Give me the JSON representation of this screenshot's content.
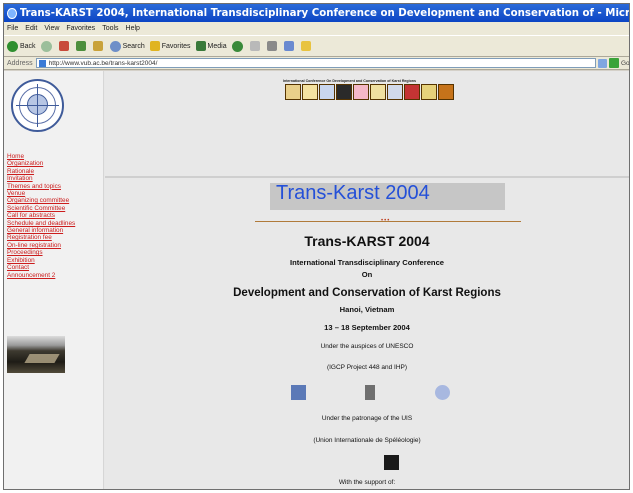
{
  "window": {
    "title": "Trans-KARST 2004, International Transdisciplinary Conference on Development and Conservation of - Microsoft Internet E..."
  },
  "menu": [
    "File",
    "Edit",
    "View",
    "Favorites",
    "Tools",
    "Help"
  ],
  "toolbar": {
    "back": "Back",
    "search": "Search",
    "favorites": "Favorites",
    "media": "Media"
  },
  "address": {
    "label": "Address",
    "url": "http://www.vub.ac.be/trans-karst2004/",
    "go": "Go"
  },
  "sidebar": {
    "links": [
      "Home",
      "Organization",
      "Rationale",
      "Invitation",
      "Themes and topics",
      "Venue",
      "Organizing committee",
      "Scientific Committee",
      "Call for abstracts",
      "Schedule and deadlines",
      "General information",
      "Registration fee",
      "On-line registration",
      "Proceedings",
      "Exhibition",
      "Contact",
      "Announcement 2"
    ]
  },
  "content": {
    "banner_caption": "International Conference On Development and Conservation of Karst Regions",
    "banner_title": "Trans-Karst 2004",
    "divider_dots": "•••",
    "heading": "Trans-KARST 2004",
    "subheading": "International Transdisciplinary Conference",
    "on": "On",
    "theme": "Development and Conservation of Karst Regions",
    "location": "Hanoi, Vietnam",
    "dates": "13 – 18 September 2004",
    "auspices": "Under the auspices of UNESCO",
    "projects": "(IGCP Project 448 and IHP)",
    "patronage": "Under the patronage of the UIS",
    "uis_full": "(Union Internationale de Spéléologie)",
    "support": "With the support of:"
  },
  "colors": {
    "link": "#cc1c1c",
    "banner_title": "#2450d8",
    "titlebar": "#0c45c4"
  }
}
